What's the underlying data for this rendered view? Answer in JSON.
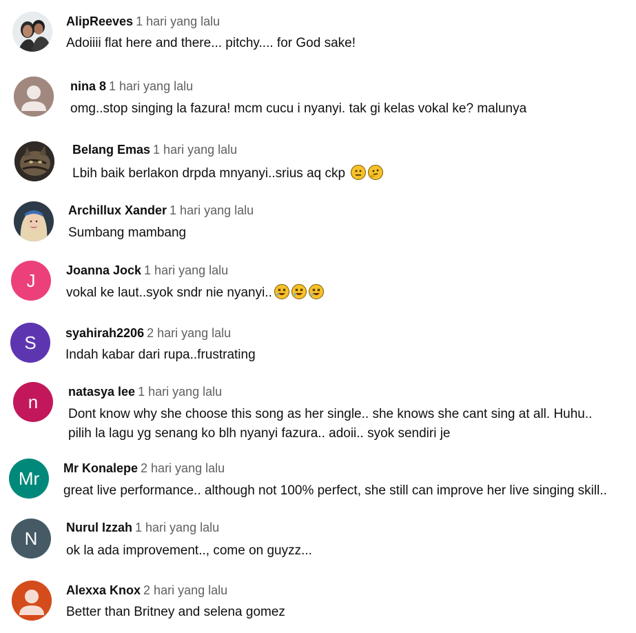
{
  "comments": [
    {
      "author": "AlipReeves",
      "time": "1 hari yang lalu",
      "text": "Adoiiii flat here and there... pitchy.... for God sake!"
    },
    {
      "author": "nina 8",
      "time": "1 hari yang lalu",
      "text": "omg..stop singing la fazura! mcm cucu i nyanyi. tak gi kelas vokal ke? malunya"
    },
    {
      "author": "Belang Emas",
      "time": "1 hari yang lalu",
      "text": "Lbih baik berlakon drpda mnyanyi..srius aq ckp"
    },
    {
      "author": "Archillux Xander",
      "time": "1 hari yang lalu",
      "text": "Sumbang mambang"
    },
    {
      "author": "Joanna Jock",
      "time": "1 hari yang lalu",
      "text": "vokal ke laut..syok sndr nie nyanyi..",
      "avatar_letter": "J",
      "avatar_color": "#ec407a"
    },
    {
      "author": "syahirah2206",
      "time": "2 hari yang lalu",
      "text": "Indah kabar dari rupa..frustrating",
      "avatar_letter": "S",
      "avatar_color": "#5e35b1"
    },
    {
      "author": "natasya lee",
      "time": "1 hari yang lalu",
      "text_line1": "Dont know why she choose this song as her single.. she knows she cant sing at all. Huhu..",
      "text_line2": "pilih la lagu yg senang ko blh nyanyi fazura.. adoii.. syok sendiri je",
      "avatar_letter": "n",
      "avatar_color": "#c2185b"
    },
    {
      "author": "Mr Konalepe",
      "time": "2 hari yang lalu",
      "text": "great live performance.. although not 100% perfect, she still can improve her live singing skill..",
      "avatar_letter": "Mr",
      "avatar_color": "#00897b"
    },
    {
      "author": "Nurul Izzah",
      "time": "1 hari yang lalu",
      "text": "ok la ada improvement.., come on guyzz...",
      "avatar_letter": "N",
      "avatar_color": "#455a64"
    },
    {
      "author": "Alexxa Knox",
      "time": "2 hari yang lalu",
      "text": "Better than Britney and selena gomez"
    }
  ],
  "emoji": {
    "belang_emas": [
      "neutral-face",
      "thinking-face"
    ],
    "joanna_jock": [
      "rofl-face",
      "rofl-face",
      "rofl-face"
    ]
  }
}
